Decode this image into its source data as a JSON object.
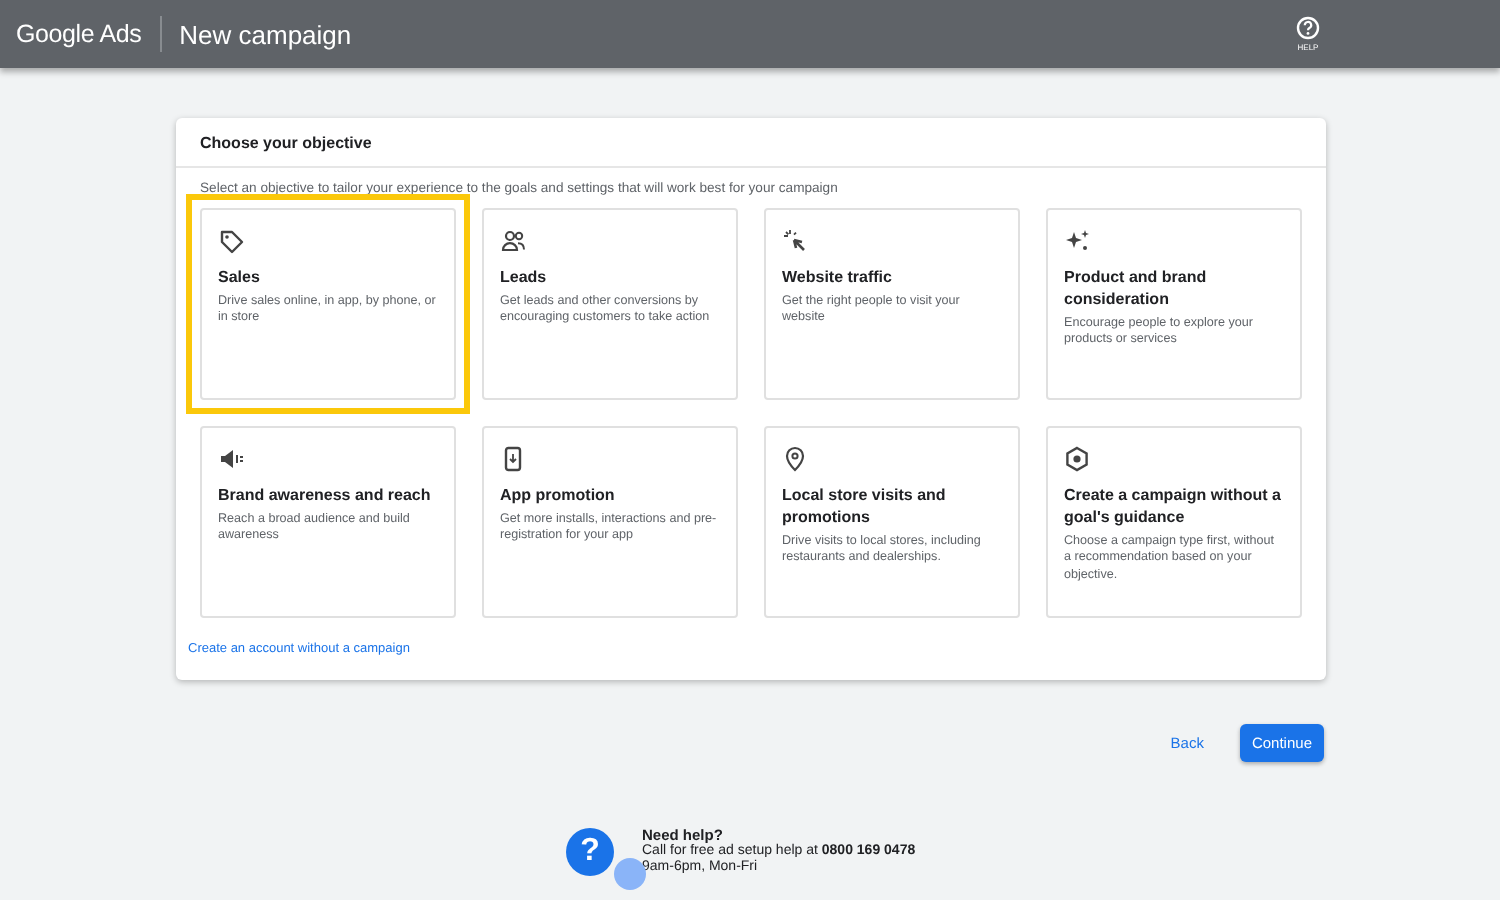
{
  "header": {
    "logo": "Google Ads",
    "title": "New campaign",
    "help_label": "HELP"
  },
  "objective_panel": {
    "title": "Choose your objective",
    "subtitle": "Select an objective to tailor your experience to the goals and settings that will work best for your campaign",
    "objectives": [
      {
        "title": "Sales",
        "description": "Drive sales online, in app, by phone, or in store",
        "selected": true
      },
      {
        "title": "Leads",
        "description": "Get leads and other conversions by encouraging customers to take action",
        "selected": false
      },
      {
        "title": "Website traffic",
        "description": "Get the right people to visit your website",
        "selected": false
      },
      {
        "title": "Product and brand consideration",
        "description": "Encourage people to explore your products or services",
        "selected": false
      },
      {
        "title": "Brand awareness and reach",
        "description": "Reach a broad audience and build awareness",
        "selected": false
      },
      {
        "title": "App promotion",
        "description": "Get more installs, interactions and pre-registration for your app",
        "selected": false
      },
      {
        "title": "Local store visits and promotions",
        "description": "Drive visits to local stores, including restaurants and dealerships.",
        "selected": false
      },
      {
        "title": "Create a campaign without a goal's guidance",
        "description": "Choose a campaign type first, without a recommendation based on your objective.",
        "selected": false
      }
    ],
    "link": "Create an account without a campaign"
  },
  "actions": {
    "back": "Back",
    "continue": "Continue"
  },
  "help": {
    "badge": "?",
    "title": "Need help?",
    "text": "Call for free ad setup help at **0800 169 0478**",
    "hours": "9am-6pm, Mon-Fri"
  }
}
